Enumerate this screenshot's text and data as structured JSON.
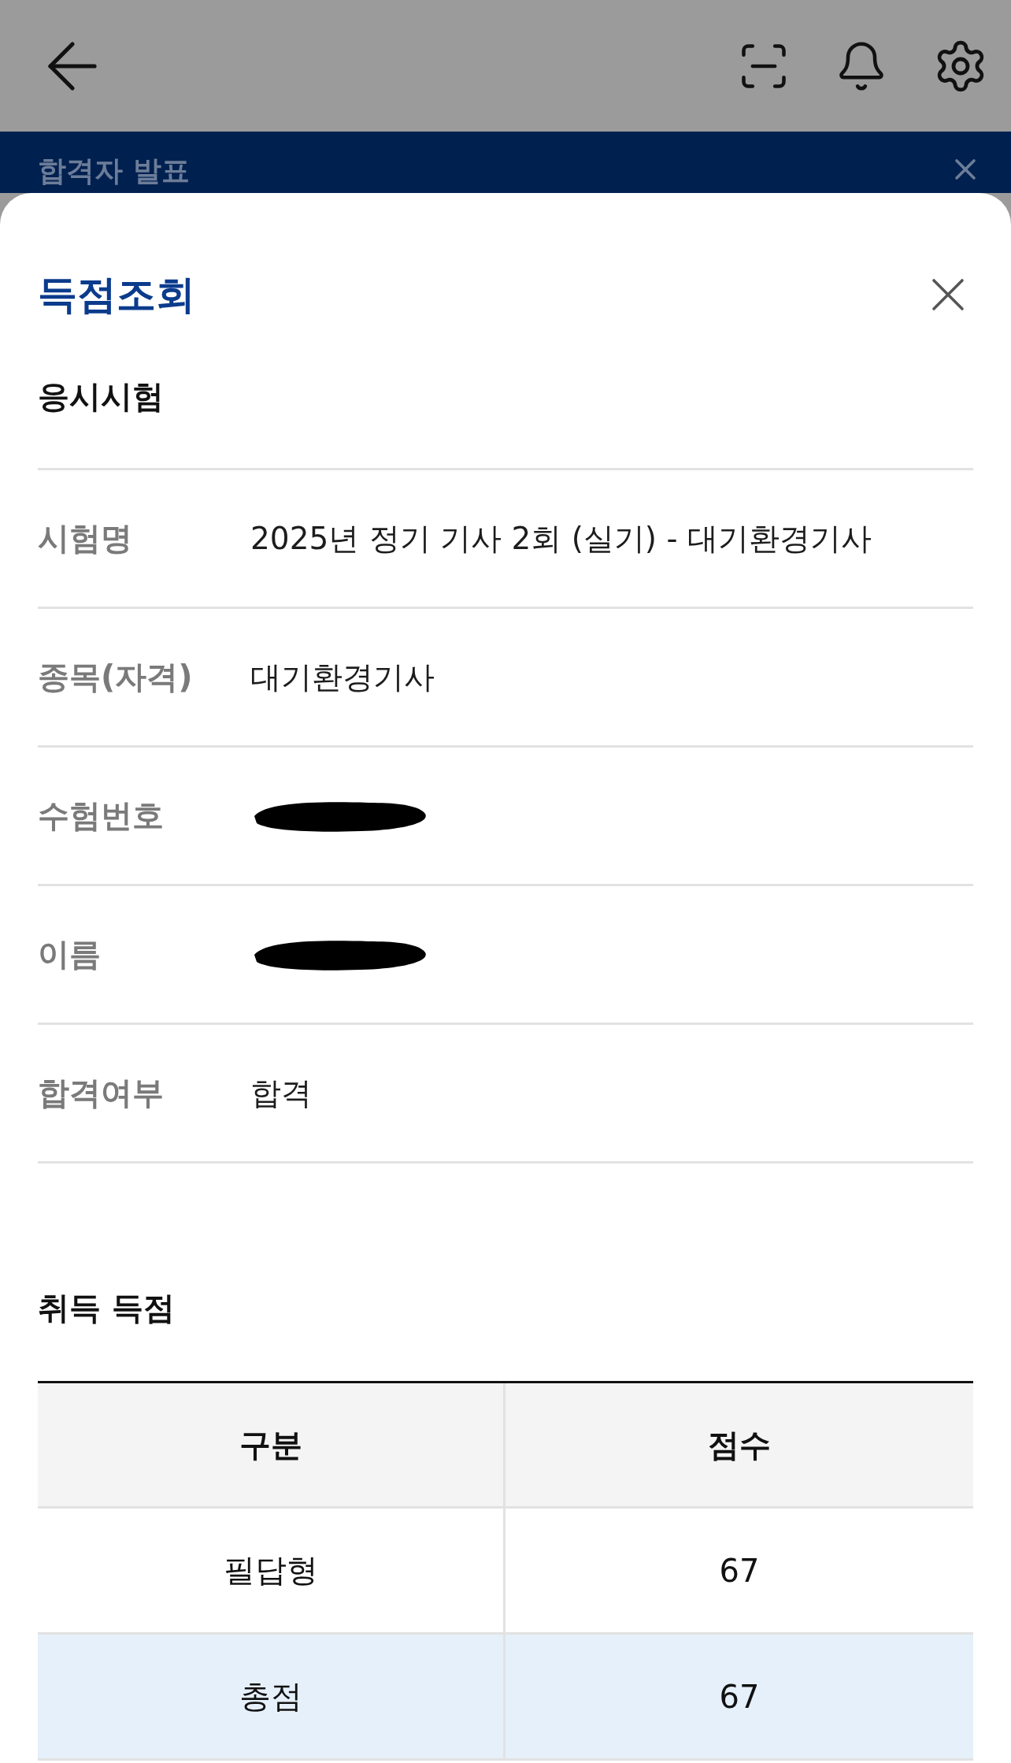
{
  "background_page": {
    "title": "합격자 발표"
  },
  "sheet": {
    "title": "득점조회",
    "section_title": "응시시험",
    "fields": [
      {
        "label": "시험명",
        "kind": "text",
        "value": "2025년 정기 기사 2회 (실기) - 대기환경기사"
      },
      {
        "label": "종목(자격)",
        "kind": "text",
        "value": "대기환경기사"
      },
      {
        "label": "수험번호",
        "kind": "redacted"
      },
      {
        "label": "이름",
        "kind": "redacted"
      },
      {
        "label": "합격여부",
        "kind": "text",
        "value": "합격"
      }
    ],
    "score_section": {
      "title": "취득 득점",
      "columns": [
        "구분",
        "점수"
      ],
      "rows": [
        {
          "kind": "normal",
          "cells": [
            "필답형",
            "67"
          ]
        },
        {
          "kind": "total",
          "cells": [
            "총점",
            "67"
          ]
        }
      ]
    }
  }
}
